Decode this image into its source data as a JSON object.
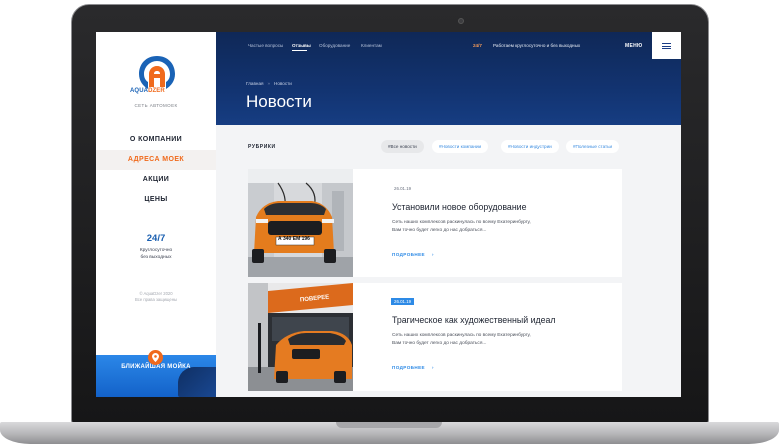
{
  "sidebar": {
    "logo_word_blue": "AQUA",
    "logo_word_orange": "DZER",
    "tagline": "СЕТЬ АВТОМОЕК",
    "menu": [
      {
        "label": "О КОМПАНИИ"
      },
      {
        "label": "АДРЕСА МОЕК"
      },
      {
        "label": "АКЦИИ"
      },
      {
        "label": "ЦЕНЫ"
      }
    ],
    "hours_big": "24/7",
    "hours_small_1": "Круглосуточно",
    "hours_small_2": "без выходных",
    "copyright_1": "© AquaDzer 2020",
    "copyright_2": "Все права защищены",
    "nearest_label": "БЛИЖАЙШАЯ МОЙКА"
  },
  "header": {
    "nav": [
      "Частые вопросы",
      "Отзывы",
      "Оборудование",
      "Клиентам"
    ],
    "hours_badge": "24/7",
    "hours_text": "Работаем круглосуточно и без выходных",
    "menu_label": "МЕНЮ",
    "breadcrumb": [
      "Главная",
      "Новости"
    ],
    "page_title": "Новости"
  },
  "rubrics": {
    "label": "РУБРИКИ",
    "items": [
      "#Все новости",
      "#Новости компании",
      "#Новости индустрии",
      "#Полезные статьи"
    ]
  },
  "news": [
    {
      "date": "26.01.19",
      "title": "Установили новое оборудование",
      "text_1": "Сеть наших комплексов раскинулась по всему Екатеринбургу,",
      "text_2": "Вам точно будет легко до нас добраться...",
      "more": "ПОДРОБНЕЕ",
      "plate": "А 340 ЕМ 196"
    },
    {
      "date": "26.01.19",
      "title": "Трагическое как художественный идеал",
      "text_1": "Сеть наших комплексов раскинулась по всему Екатеринбургу,",
      "text_2": "Вам точно будет легко до нас добраться...",
      "more": "ПОДРОБНЕЕ",
      "sign": "ПОВЕРЕЕ"
    }
  ],
  "colors": {
    "brand_blue": "#1a63b6",
    "accent_orange": "#f06a1c",
    "link_blue": "#2d8ae6",
    "hero_navy": "#123370"
  }
}
